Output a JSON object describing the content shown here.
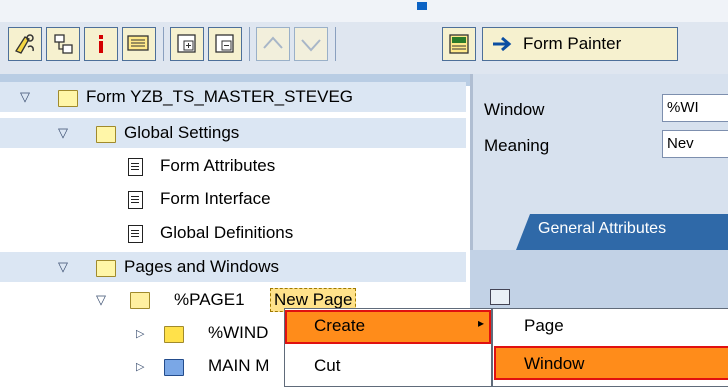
{
  "toolbar": {
    "buttons": [
      {
        "name": "edit-link-icon"
      },
      {
        "name": "hierarchy-icon"
      },
      {
        "name": "info-icon"
      },
      {
        "name": "print-preview-icon"
      },
      {
        "name": "expand-all-icon"
      },
      {
        "name": "collapse-all-icon"
      },
      {
        "name": "move-up-icon"
      },
      {
        "name": "move-down-icon"
      },
      {
        "name": "table-icon"
      }
    ],
    "form_painter_label": "Form Painter"
  },
  "tree": {
    "items": [
      {
        "label": "Form YZB_TS_MASTER_STEVEG"
      },
      {
        "label": "Global Settings"
      },
      {
        "label": "Form Attributes"
      },
      {
        "label": "Form Interface"
      },
      {
        "label": "Global Definitions"
      },
      {
        "label": "Pages and Windows"
      },
      {
        "label": "%PAGE1",
        "suffix": "New Page"
      },
      {
        "label": "%WIND"
      },
      {
        "label": "MAIN M"
      }
    ]
  },
  "details": {
    "window_label": "Window",
    "window_value": "%WI",
    "meaning_label": "Meaning",
    "meaning_value": "Nev",
    "tab_label": "General Attributes"
  },
  "context_menu": {
    "items": [
      {
        "label": "Create"
      },
      {
        "label": "Cut"
      }
    ]
  },
  "submenu": {
    "items": [
      {
        "label": "Page"
      },
      {
        "label": "Window"
      }
    ]
  },
  "colors": {
    "highlight": "#ff8c1a",
    "highlight_border": "#e01010",
    "tab_blue": "#2f69a8"
  }
}
